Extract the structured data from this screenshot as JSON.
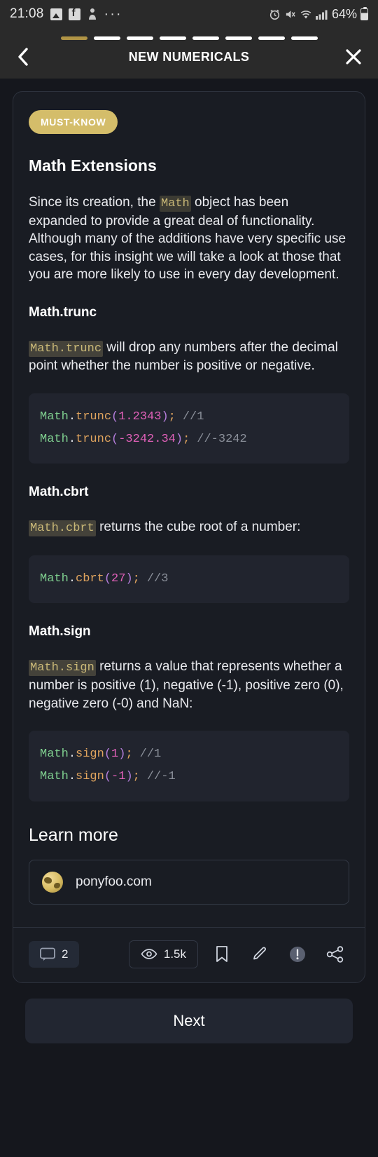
{
  "status_bar": {
    "time": "21:08",
    "icons": [
      "image-icon",
      "facebook-icon",
      "app-icon",
      "more-icon"
    ],
    "alarm_icon": "alarm-icon",
    "mute_icon": "mute-icon",
    "wifi_icon": "wifi-icon",
    "signal_icon": "signal-icon",
    "battery_percent": "64%"
  },
  "nav": {
    "title": "NEW NUMERICALS",
    "back_icon": "chevron-left-icon",
    "close_icon": "close-icon",
    "progress_total": 8,
    "progress_current": 1,
    "active_color": "#b09445",
    "inactive_color": "#ffffff"
  },
  "card": {
    "badge": "MUST-KNOW",
    "badge_color": "#d4bd6a",
    "title": "Math Extensions",
    "intro_before": "Since its creation, the ",
    "intro_code": "Math",
    "intro_after": " object has been expanded to provide a great deal of functionality. Although many of the additions have very specific use cases, for this insight we will take a look at those that you are more likely to use in every day development.",
    "sections": [
      {
        "heading": "Math.trunc",
        "desc_code": "Math.trunc",
        "desc_after": " will drop any numbers after the decimal point whether the number is positive or negative.",
        "code_lines": [
          {
            "obj": "Math",
            "dot": ".",
            "fn": "trunc",
            "open": "(",
            "num": "1.2343",
            "close": ")",
            "semi": ";",
            "comment": "//1"
          },
          {
            "obj": "Math",
            "dot": ".",
            "fn": "trunc",
            "open": "(",
            "num": "-3242.34",
            "close": ")",
            "semi": ";",
            "comment": "//-3242"
          }
        ]
      },
      {
        "heading": "Math.cbrt",
        "desc_code": "Math.cbrt",
        "desc_after": " returns the cube root of a number:",
        "code_lines": [
          {
            "obj": "Math",
            "dot": ".",
            "fn": "cbrt",
            "open": "(",
            "num": "27",
            "close": ")",
            "semi": ";",
            "comment": "//3"
          }
        ]
      },
      {
        "heading": "Math.sign",
        "desc_code": "Math.sign",
        "desc_after": " returns a value that represents whether a number is positive (1), negative (-1), positive zero (0), negative zero (-0) and NaN:",
        "code_lines": [
          {
            "obj": "Math",
            "dot": ".",
            "fn": "sign",
            "open": "(",
            "num": "1",
            "close": ")",
            "semi": ";",
            "comment": "//1"
          },
          {
            "obj": "Math",
            "dot": ".",
            "fn": "sign",
            "open": "(",
            "num": "-1",
            "close": ")",
            "semi": ";",
            "comment": "//-1"
          }
        ]
      }
    ],
    "learn_more_heading": "Learn more",
    "link": {
      "icon": "globe-icon",
      "url": "ponyfoo.com"
    }
  },
  "actions": {
    "comments_icon": "comment-icon",
    "comments_count": "2",
    "views_icon": "eye-icon",
    "views_count": "1.5k",
    "bookmark_icon": "bookmark-icon",
    "edit_icon": "pencil-icon",
    "report_icon": "alert-icon",
    "share_icon": "share-icon"
  },
  "footer": {
    "next_label": "Next"
  },
  "syntax_colors": {
    "object": "#7fcf8f",
    "function": "#e0a45e",
    "paren": "#b57edc",
    "number": "#e060b8",
    "comment": "#8a8f99",
    "code_bg": "#21242e",
    "inline_code_bg": "#3c3b33",
    "inline_code_fg": "#c9b877"
  }
}
